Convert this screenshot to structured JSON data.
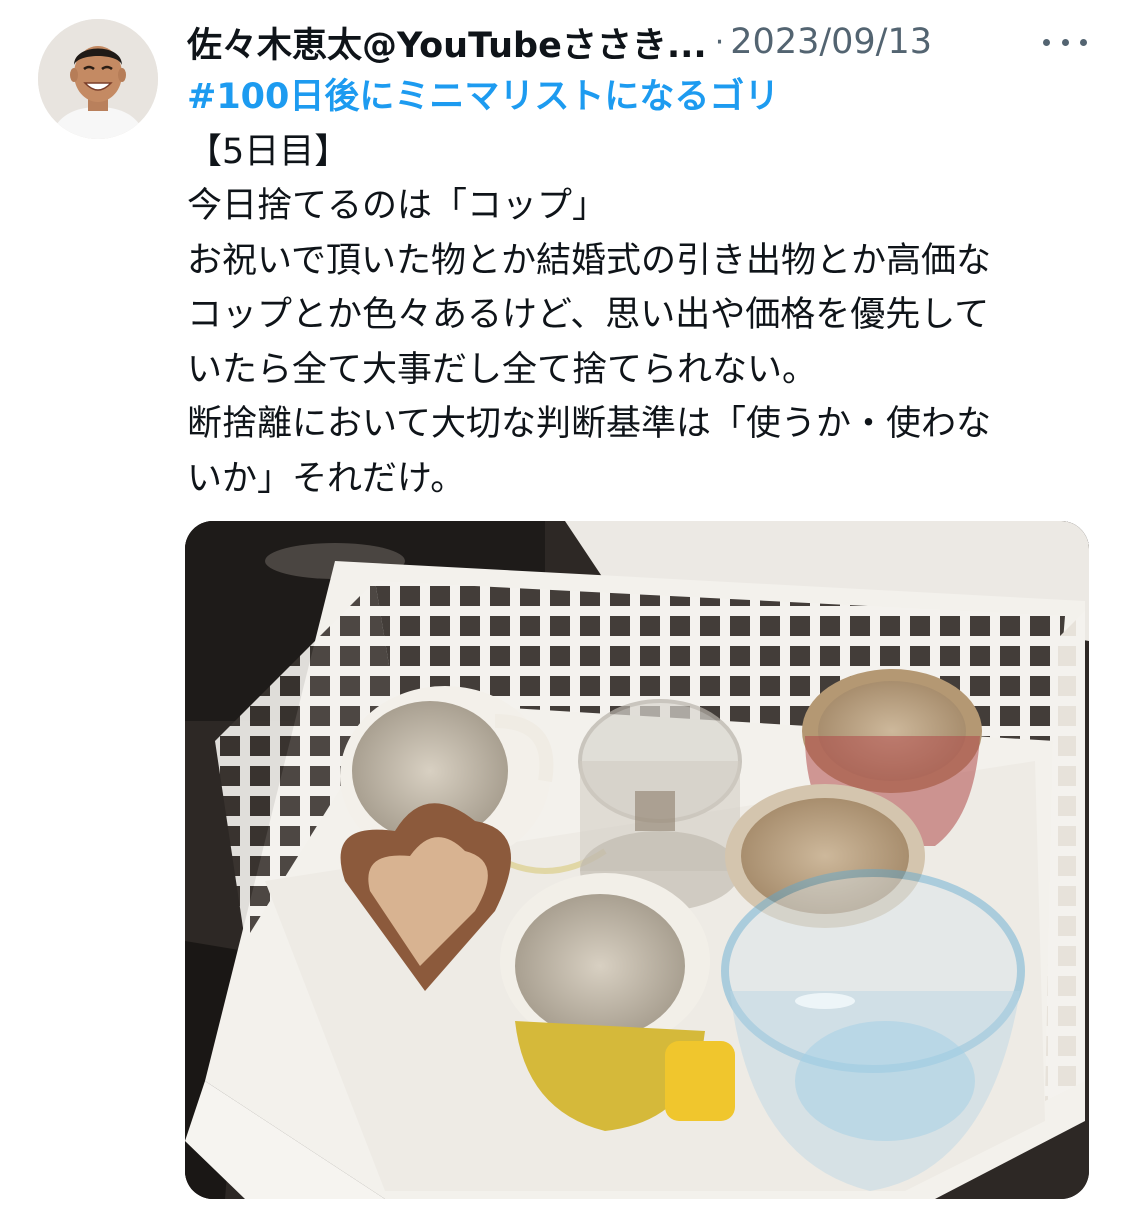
{
  "tweet": {
    "author_name": "佐々木恵太@YouTubeささき...",
    "separator": "·",
    "date": "2023/09/13",
    "hashtag": "#100日後にミニマリストになるゴリ",
    "lines": [
      "【5日目】",
      "今日捨てるのは「コップ」",
      "お祝いで頂いた物とか結婚式の引き出物とか高価な",
      "コップとか色々あるけど、思い出や価格を優先して",
      "いたら全て大事だし全て捨てられない。",
      "断捨離において大切な判断基準は「使うか・使わな",
      "いか」それだけ。"
    ]
  },
  "icons": {
    "avatar": "profile-photo",
    "more": "more-options-icon"
  },
  "colors": {
    "text": "#0f1419",
    "secondary": "#536471",
    "hashtag": "#1d9bf0"
  }
}
